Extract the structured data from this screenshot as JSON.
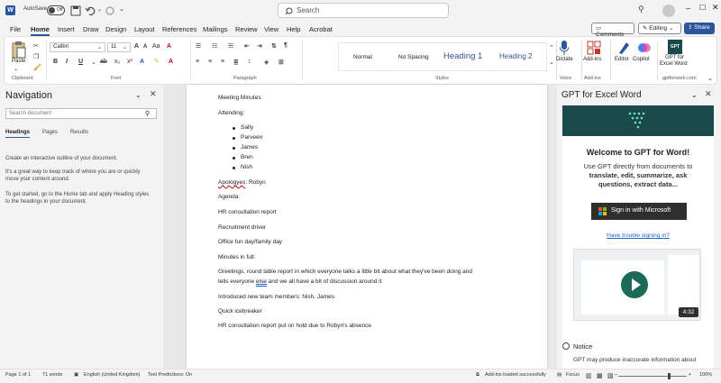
{
  "titlebar": {
    "autosave_label": "AutoSave",
    "autosave_state": "Off",
    "search_placeholder": "Search"
  },
  "menu": {
    "tabs": [
      "File",
      "Home",
      "Insert",
      "Draw",
      "Design",
      "Layout",
      "References",
      "Mailings",
      "Review",
      "View",
      "Help",
      "Acrobat"
    ],
    "active": "Home",
    "comments_label": "Comments",
    "editing_label": "Editing",
    "share_label": "Share"
  },
  "ribbon": {
    "paste_label": "Paste",
    "font_name": "Calibri",
    "font_size": "11",
    "styles": [
      "Normal",
      "No Spacing",
      "Heading 1",
      "Heading 2"
    ],
    "dictate_label": "Dictate",
    "addins_label": "Add-ins",
    "editor_label": "Editor",
    "copilot_label": "Copilot",
    "gpt_label_1": "GPT for",
    "gpt_label_2": "Excel Word",
    "groups": {
      "clipboard": "Clipboard",
      "font": "Font",
      "paragraph": "Paragraph",
      "styles": "Styles",
      "voice": "Voice",
      "addins": "Add-ins",
      "gptforwork": "gptforwork.com"
    },
    "accent_color": "#2b579a"
  },
  "navigation": {
    "title": "Navigation",
    "search_placeholder": "Search document",
    "tabs": [
      "Headings",
      "Pages",
      "Results"
    ],
    "active_tab": "Headings",
    "text_1": "Create an interactive outline of your document.",
    "text_2a": "It's a great way to keep track of where you are or quickly",
    "text_2b": "move your content around.",
    "text_3a": "To get started, go to the Home tab and apply Heading styles",
    "text_3b": "to the headings in your document."
  },
  "document": {
    "title": "Meeting Minutes",
    "attending_label": "Attending:",
    "attendees": [
      "Sally",
      "Parveen",
      "James",
      "Bren",
      "Nish"
    ],
    "apologies_word": "Apologyes",
    "apologies_rest": ": Robyn",
    "agenda_label": "Agenda:",
    "agenda_items": [
      "HR consultation report",
      "Recruitment driver",
      "Office fun day/family day"
    ],
    "minutes_label": "Minutes in full:",
    "para_line1": "Greetings, round table report in which everyone talks a little bit about what they've been doing and",
    "para_line2_a": "tells everyone ",
    "para_line2_b": "else",
    "para_line2_c": " and we all have a bit of discussion around it",
    "line_team": "Introduced new team members: Nish, James",
    "line_icebreaker": "Quick icebreaker",
    "line_hr": "HR consultation report put on hold due to Robyn's absence"
  },
  "gpt_pane": {
    "title": "GPT for Excel Word",
    "welcome": "Welcome to GPT for Word!",
    "sub_1": "Use GPT directly from documents to",
    "sub_2": "translate, edit, summarize, ask",
    "sub_3": "questions, extract data...",
    "signin_label": "Sign in with Microsoft",
    "trouble_link": "Have trouble signing in?",
    "video_duration": "4:32",
    "notice_title": "Notice",
    "notice_text": "GPT may produce inaccurate information about",
    "brand_color": "#1b4a4a"
  },
  "status": {
    "page": "Page 1 of 1",
    "words": "71 words",
    "language": "English (United Kingdom)",
    "predictions": "Text Predictions: On",
    "addins": "Add-ins loaded successfully",
    "focus": "Focus",
    "zoom": "100%"
  }
}
